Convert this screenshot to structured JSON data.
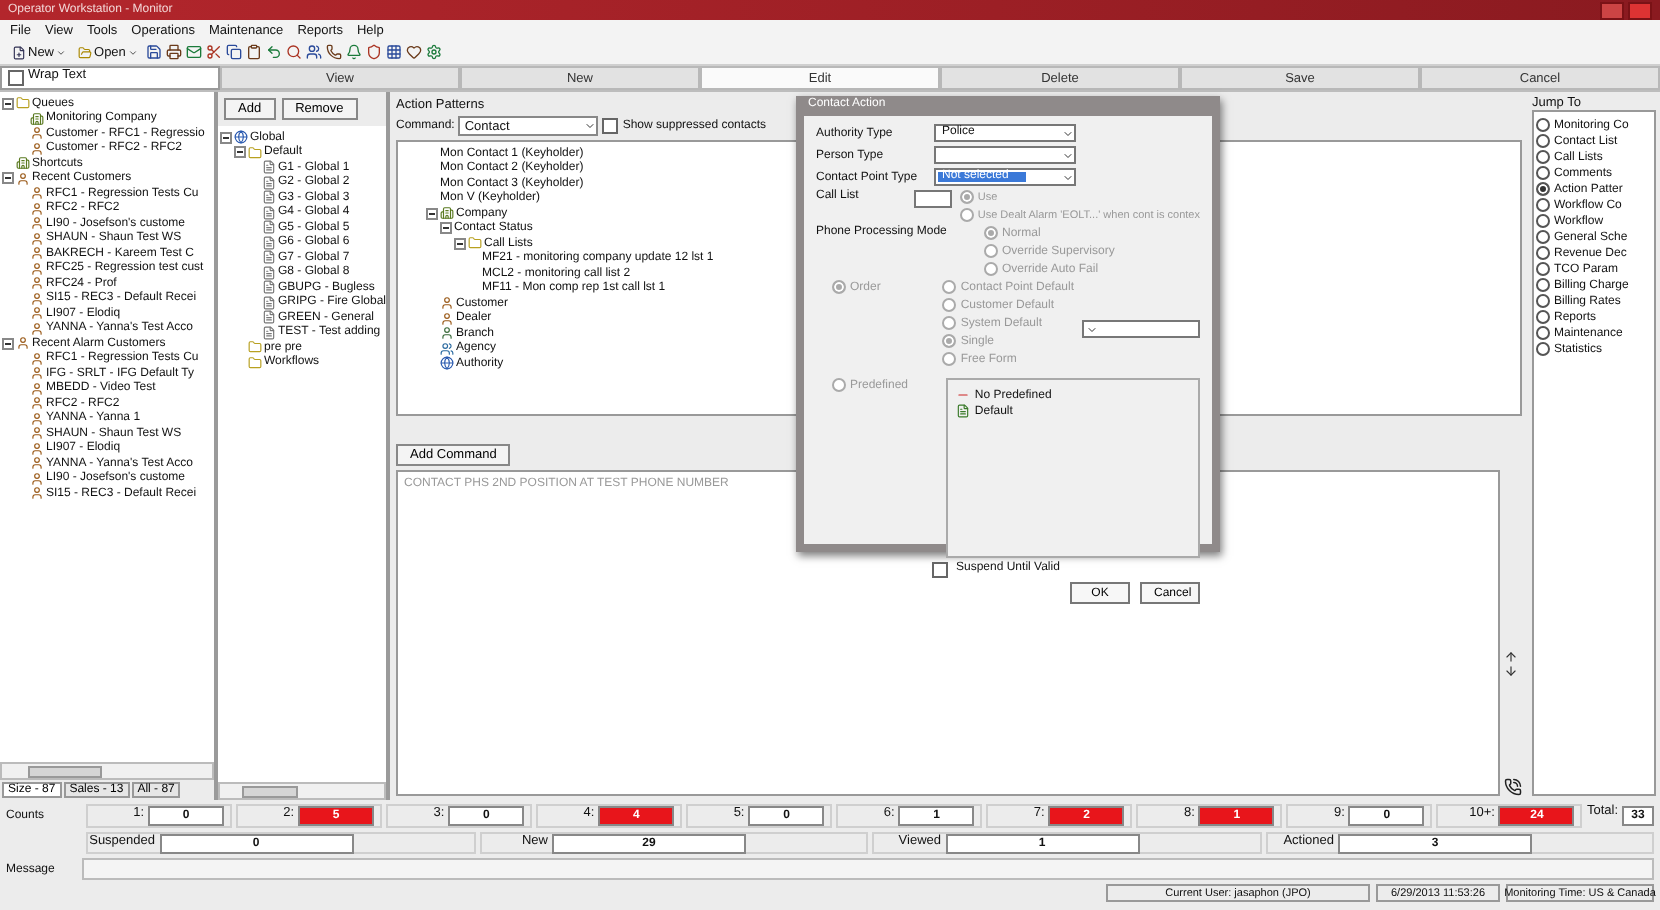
{
  "window": {
    "title": "Operator Workstation - Monitor"
  },
  "menu": [
    "File",
    "View",
    "Tools",
    "Operations",
    "Maintenance",
    "Reports",
    "Help"
  ],
  "toolbar": [
    "New",
    "Open"
  ],
  "wrap_text": {
    "label": "Wrap Text",
    "checked": false
  },
  "actions": [
    {
      "label": "View",
      "selected": false
    },
    {
      "label": "New",
      "selected": false
    },
    {
      "label": "Edit",
      "selected": true
    },
    {
      "label": "Delete",
      "selected": false
    },
    {
      "label": "Save",
      "selected": false
    },
    {
      "label": "Cancel",
      "selected": false
    }
  ],
  "queue_tree": [
    {
      "label": "Queues",
      "kind": "folder",
      "expanded": true,
      "children": [
        {
          "label": "Monitoring Company",
          "kind": "company"
        },
        {
          "label": "Customer - RFC1 - Regressio",
          "kind": "customer"
        },
        {
          "label": "Customer - RFC2 - RFC2",
          "kind": "customer"
        }
      ]
    },
    {
      "label": "Shortcuts",
      "kind": "company"
    },
    {
      "label": "Recent Customers",
      "kind": "customer",
      "expanded": true,
      "children": [
        {
          "label": "RFC1 - Regression Tests Cu",
          "kind": "customer"
        },
        {
          "label": "RFC2 - RFC2",
          "kind": "customer"
        },
        {
          "label": "LI90 - Josefson's custome",
          "kind": "customer"
        },
        {
          "label": "SHAUN - Shaun Test WS",
          "kind": "customer"
        },
        {
          "label": "BAKRECH - Kareem Test C",
          "kind": "customer"
        },
        {
          "label": "RFC25 - Regression test cust",
          "kind": "customer"
        },
        {
          "label": "RFC24 - Prof",
          "kind": "customer"
        },
        {
          "label": "SI15 - REC3 - Default Recei",
          "kind": "customer"
        },
        {
          "label": "LI907 - Elodiq",
          "kind": "customer"
        },
        {
          "label": "YANNA - Yanna's Test Acco",
          "kind": "customer"
        }
      ]
    },
    {
      "label": "Recent Alarm Customers",
      "kind": "customer",
      "expanded": true,
      "children": [
        {
          "label": "RFC1 - Regression Tests Cu",
          "kind": "customer"
        },
        {
          "label": "IFG - SRLT - IFG Default Ty",
          "kind": "customer"
        },
        {
          "label": "MBEDD - Video Test",
          "kind": "customer"
        },
        {
          "label": "RFC2 - RFC2",
          "kind": "customer"
        },
        {
          "label": "YANNA - Yanna 1",
          "kind": "customer"
        },
        {
          "label": "SHAUN - Shaun Test WS",
          "kind": "customer"
        },
        {
          "label": "LI907 - Elodiq",
          "kind": "customer"
        },
        {
          "label": "YANNA - Yanna's Test Acco",
          "kind": "customer"
        },
        {
          "label": "LI90 - Josefson's custome",
          "kind": "customer"
        },
        {
          "label": "SI15 - REC3 - Default Recei",
          "kind": "customer"
        }
      ]
    }
  ],
  "queue_tabs": [
    {
      "label": "Size - 87",
      "selected": true
    },
    {
      "label": "Sales - 13",
      "selected": false
    },
    {
      "label": "All - 87",
      "selected": false
    }
  ],
  "pattern_buttons": [
    "Add",
    "Remove"
  ],
  "pattern_tree": [
    {
      "label": "Global",
      "kind": "global",
      "expanded": true,
      "children": [
        {
          "label": "Default",
          "kind": "folder",
          "expanded": true,
          "children": [
            {
              "label": "G1 - Global 1",
              "kind": "item"
            },
            {
              "label": "G2 - Global 2",
              "kind": "item"
            },
            {
              "label": "G3 - Global 3",
              "kind": "item"
            },
            {
              "label": "G4 - Global 4",
              "kind": "item"
            },
            {
              "label": "G5 - Global 5",
              "kind": "item"
            },
            {
              "label": "G6 - Global 6",
              "kind": "item"
            },
            {
              "label": "G7 - Global 7",
              "kind": "item"
            },
            {
              "label": "G8 - Global 8",
              "kind": "item"
            },
            {
              "label": "GBUPG - Bugless",
              "kind": "item"
            },
            {
              "label": "GRIPG - Fire Global",
              "kind": "item"
            },
            {
              "label": "GREEN - General",
              "kind": "item"
            },
            {
              "label": "TEST - Test adding",
              "kind": "item"
            }
          ]
        },
        {
          "label": "pre pre",
          "kind": "folder"
        },
        {
          "label": "Workflows",
          "kind": "folder"
        }
      ]
    }
  ],
  "action_patterns": {
    "title": "Action Patterns",
    "command_label": "Command:",
    "command_value": "Contact",
    "show_suppressed": {
      "label": "Show suppressed contacts",
      "checked": false
    },
    "tree": [
      {
        "label": "Mon Contact 1 (Keyholder)"
      },
      {
        "label": "Mon Contact 2 (Keyholder)"
      },
      {
        "label": "Mon Contact 3 (Keyholder)"
      },
      {
        "label": "Mon V (Keyholder)"
      },
      {
        "label": "Company",
        "kind": "company",
        "expanded": true,
        "children": [
          {
            "label": "Contact Status",
            "expanded": true,
            "children": [
              {
                "label": "Call Lists",
                "kind": "folder",
                "expanded": true,
                "children": [
                  {
                    "label": "MF21 - monitoring company update 12 lst 1"
                  },
                  {
                    "label": "MCL2 - monitoring call list 2"
                  },
                  {
                    "label": "MF11 - Mon comp rep 1st call lst 1"
                  }
                ]
              }
            ]
          }
        ]
      },
      {
        "label": "Customer",
        "kind": "customer"
      },
      {
        "label": "Dealer",
        "kind": "customer"
      },
      {
        "label": "Branch",
        "kind": "branch"
      },
      {
        "label": "Agency",
        "kind": "agency"
      },
      {
        "label": "Authority",
        "kind": "global"
      }
    ],
    "add_command": "Add Command",
    "command_text": "CONTACT PHS 2ND POSITION AT TEST PHONE NUMBER"
  },
  "dialog": {
    "title": "Contact Action",
    "fields": [
      {
        "label": "Authority Type",
        "value": "Police",
        "highlighted": false
      },
      {
        "label": "Person Type",
        "highlighted": false
      },
      {
        "label": "Contact Point Type",
        "value": "Not selected",
        "highlighted": true
      }
    ],
    "call_list_label": "Call List",
    "call_list_options": [
      {
        "label": "Use",
        "selected": true
      },
      {
        "label": "Use Dealt Alarm 'EOLT...' when cont is contex",
        "selected": false
      }
    ],
    "phone_label": "Phone Processing Mode",
    "phone_options": [
      {
        "label": "Normal",
        "selected": true
      },
      {
        "label": "Override Supervisory",
        "selected": false
      },
      {
        "label": "Override Auto Fail",
        "selected": false
      }
    ],
    "order": {
      "label": "Order",
      "selected": true
    },
    "order_options": [
      {
        "label": "Contact Point Default",
        "selected": false
      },
      {
        "label": "Customer Default",
        "selected": false
      },
      {
        "label": "System Default",
        "selected": false
      },
      {
        "label": "Single",
        "selected": true
      },
      {
        "label": "Free Form",
        "selected": false
      }
    ],
    "predefined": {
      "label": "Predefined",
      "selected": false
    },
    "predefined_items": [
      {
        "label": "No Predefined",
        "kind": "none"
      },
      {
        "label": "Default",
        "kind": "list"
      }
    ],
    "suspend": {
      "label": "Suspend Until Valid",
      "checked": false
    },
    "buttons": [
      "OK",
      "Cancel"
    ]
  },
  "jump_to": {
    "title": "Jump To",
    "items": [
      {
        "label": "Monitoring Co",
        "selected": false
      },
      {
        "label": "Contact List",
        "selected": false
      },
      {
        "label": "Call Lists",
        "selected": false
      },
      {
        "label": "Comments",
        "selected": false
      },
      {
        "label": "Action Patter",
        "selected": true
      },
      {
        "label": "Workflow Co",
        "selected": false
      },
      {
        "label": "Workflow",
        "selected": false
      },
      {
        "label": "General Sche",
        "selected": false
      },
      {
        "label": "Revenue Dec",
        "selected": false
      },
      {
        "label": "TCO Param",
        "selected": false
      },
      {
        "label": "Billing Charge",
        "selected": false
      },
      {
        "label": "Billing Rates",
        "selected": false
      },
      {
        "label": "Reports",
        "selected": false
      },
      {
        "label": "Maintenance",
        "selected": false
      },
      {
        "label": "Statistics",
        "selected": false
      }
    ]
  },
  "counts": {
    "label": "Counts",
    "items": [
      {
        "label": "1:",
        "value": "0",
        "alert": false
      },
      {
        "label": "2:",
        "value": "5",
        "alert": true
      },
      {
        "label": "3:",
        "value": "0",
        "alert": false
      },
      {
        "label": "4:",
        "value": "4",
        "alert": true
      },
      {
        "label": "5:",
        "value": "0",
        "alert": false
      },
      {
        "label": "6:",
        "value": "1",
        "alert": false
      },
      {
        "label": "7:",
        "value": "2",
        "alert": true
      },
      {
        "label": "8:",
        "value": "1",
        "alert": true
      },
      {
        "label": "9:",
        "value": "0",
        "alert": false
      },
      {
        "label": "10+:",
        "value": "24",
        "alert": true
      }
    ],
    "total_label": "Total:",
    "total": "33"
  },
  "stats": [
    {
      "label": "Suspended",
      "value": "0"
    },
    {
      "label": "New",
      "value": "29"
    },
    {
      "label": "Viewed",
      "value": "1"
    },
    {
      "label": "Actioned",
      "value": "3"
    }
  ],
  "message_label": "Message",
  "status_bar": [
    "Current User: jasaphon (JPO)",
    "6/29/2013 11:53:26",
    "Monitoring Time: US & Canada"
  ]
}
